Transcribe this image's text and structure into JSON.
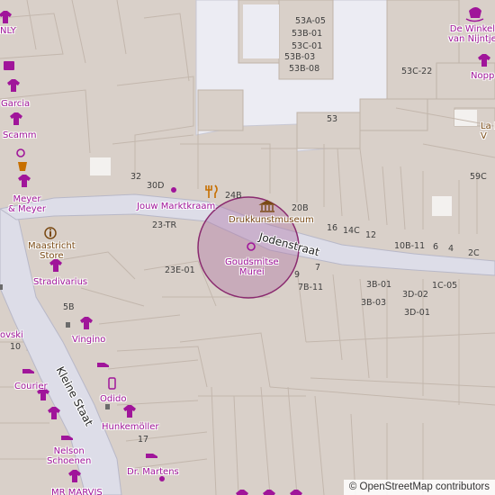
{
  "map": {
    "colors": {
      "building": "#d9d0c9",
      "building_outline": "#bfb3a9",
      "pedestrian": "#dddde8",
      "pedestrian_outline": "#b8b8c8",
      "square": "#ececf3",
      "shop": "#a0159a",
      "poi_brown": "#7a4a14",
      "circle_fill": "#b076a8",
      "circle_stroke": "#8a2a6f"
    },
    "streets": {
      "jodenstraat": "Jodenstraat",
      "kleine_staat": "Kleine Staat"
    },
    "pois": {
      "nly": "NLY",
      "garcia": "Garcia",
      "scamm": "Scamm",
      "meyer": "Meyer\n& Meyer",
      "jouw_marktkraam": "Jouw Marktkraam",
      "drukkunstmuseum": "Drukkunstmuseum",
      "maastricht_store": "Maastricht\nStore",
      "stradivarius": "Stradivarius",
      "goudsmitse_murei": "Goudsmitse\nMurei",
      "vingino": "Vingino",
      "ovski": "ovski",
      "courier": "Courier",
      "odido": "Odido",
      "hunkemoller": "Hunkemöller",
      "nelson_schoenen": "Nelson\nSchoenen",
      "dr_martens": "Dr. Martens",
      "mr_marvis": "MR MARVIS",
      "de_winkel": "De Winkel\nvan Nijntje",
      "nopp": "Nopp",
      "la_l": "La L\nV"
    },
    "house_numbers": {
      "n53a05": "53A-05",
      "n53b01": "53B-01",
      "n53c01": "53C-01",
      "n53b03": "53B-03",
      "n53b08": "53B-08",
      "n53c22": "53C-22",
      "n53": "53",
      "n59c": "59C",
      "n32": "32",
      "n30d": "30D",
      "n24b": "24B",
      "n20b": "20B",
      "n23tr": "23-TR",
      "n16": "16",
      "n14c": "14C",
      "n12": "12",
      "n10b11": "10B-11",
      "n6": "6",
      "n4": "4",
      "n2c": "2C",
      "n23e01": "23E-01",
      "n9": "9",
      "n7": "7",
      "n7b11": "7B-11",
      "n3b01": "3B-01",
      "n1c05": "1C-05",
      "n3d02": "3D-02",
      "n3b03": "3B-03",
      "n3d01": "3D-01",
      "n5b": "5B",
      "n10": "10",
      "n17": "17"
    },
    "attribution": "© OpenStreetMap contributors"
  }
}
